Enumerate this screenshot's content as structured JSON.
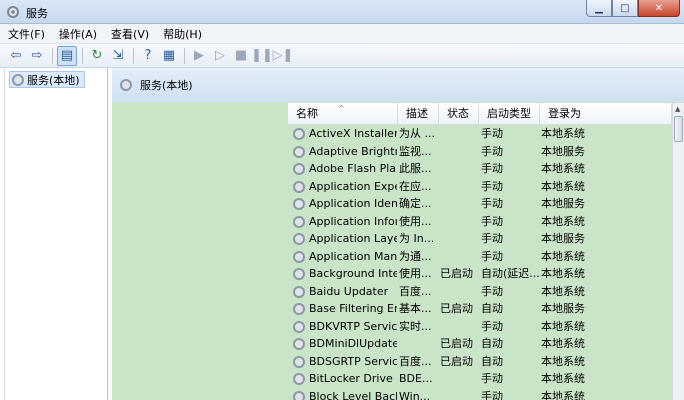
{
  "window": {
    "title": "服务"
  },
  "menu": [
    "文件(F)",
    "操作(A)",
    "查看(V)",
    "帮助(H)"
  ],
  "tree": {
    "selected_label": "服务(本地)"
  },
  "main": {
    "header_title": "服务(本地)"
  },
  "columns": [
    "名称",
    "描述",
    "状态",
    "启动类型",
    "登录为"
  ],
  "rows": [
    {
      "name": "ActiveX Installer ...",
      "desc": "为从 ...",
      "status": "",
      "startup": "手动",
      "logon": "本地系统"
    },
    {
      "name": "Adaptive Brightn...",
      "desc": "监视...",
      "status": "",
      "startup": "手动",
      "logon": "本地服务"
    },
    {
      "name": "Adobe Flash Pla...",
      "desc": "此服...",
      "status": "",
      "startup": "手动",
      "logon": "本地系统"
    },
    {
      "name": "Application Expe...",
      "desc": "在应...",
      "status": "",
      "startup": "手动",
      "logon": "本地系统"
    },
    {
      "name": "Application Iden...",
      "desc": "确定...",
      "status": "",
      "startup": "手动",
      "logon": "本地服务"
    },
    {
      "name": "Application Infor...",
      "desc": "使用...",
      "status": "",
      "startup": "手动",
      "logon": "本地系统"
    },
    {
      "name": "Application Laye...",
      "desc": "为 In...",
      "status": "",
      "startup": "手动",
      "logon": "本地服务"
    },
    {
      "name": "Application Man...",
      "desc": "为通...",
      "status": "",
      "startup": "手动",
      "logon": "本地系统"
    },
    {
      "name": "Background Inte...",
      "desc": "使用...",
      "status": "已启动",
      "startup": "自动(延迟...",
      "logon": "本地系统"
    },
    {
      "name": "Baidu Updater",
      "desc": "百度...",
      "status": "",
      "startup": "手动",
      "logon": "本地系统"
    },
    {
      "name": "Base Filtering En...",
      "desc": "基本...",
      "status": "已启动",
      "startup": "自动",
      "logon": "本地服务"
    },
    {
      "name": "BDKVRTP Service",
      "desc": "实时...",
      "status": "",
      "startup": "手动",
      "logon": "本地系统"
    },
    {
      "name": "BDMiniDlUpdate",
      "desc": "",
      "status": "已启动",
      "startup": "自动",
      "logon": "本地系统"
    },
    {
      "name": "BDSGRTP Service",
      "desc": "百度...",
      "status": "已启动",
      "startup": "自动",
      "logon": "本地系统"
    },
    {
      "name": "BitLocker Drive ...",
      "desc": "BDE...",
      "status": "",
      "startup": "手动",
      "logon": "本地系统"
    },
    {
      "name": "Block Level Back...",
      "desc": "Win...",
      "status": "",
      "startup": "手动",
      "logon": "本地系统"
    }
  ]
}
